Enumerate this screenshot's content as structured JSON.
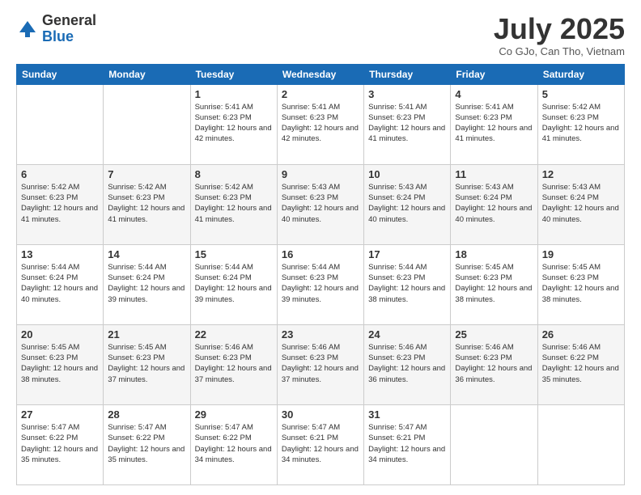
{
  "logo": {
    "general": "General",
    "blue": "Blue"
  },
  "header": {
    "month": "July 2025",
    "location": "Co GJo, Can Tho, Vietnam"
  },
  "days_of_week": [
    "Sunday",
    "Monday",
    "Tuesday",
    "Wednesday",
    "Thursday",
    "Friday",
    "Saturday"
  ],
  "weeks": [
    [
      {
        "day": "",
        "info": ""
      },
      {
        "day": "",
        "info": ""
      },
      {
        "day": "1",
        "info": "Sunrise: 5:41 AM\nSunset: 6:23 PM\nDaylight: 12 hours and 42 minutes."
      },
      {
        "day": "2",
        "info": "Sunrise: 5:41 AM\nSunset: 6:23 PM\nDaylight: 12 hours and 42 minutes."
      },
      {
        "day": "3",
        "info": "Sunrise: 5:41 AM\nSunset: 6:23 PM\nDaylight: 12 hours and 41 minutes."
      },
      {
        "day": "4",
        "info": "Sunrise: 5:41 AM\nSunset: 6:23 PM\nDaylight: 12 hours and 41 minutes."
      },
      {
        "day": "5",
        "info": "Sunrise: 5:42 AM\nSunset: 6:23 PM\nDaylight: 12 hours and 41 minutes."
      }
    ],
    [
      {
        "day": "6",
        "info": "Sunrise: 5:42 AM\nSunset: 6:23 PM\nDaylight: 12 hours and 41 minutes."
      },
      {
        "day": "7",
        "info": "Sunrise: 5:42 AM\nSunset: 6:23 PM\nDaylight: 12 hours and 41 minutes."
      },
      {
        "day": "8",
        "info": "Sunrise: 5:42 AM\nSunset: 6:23 PM\nDaylight: 12 hours and 41 minutes."
      },
      {
        "day": "9",
        "info": "Sunrise: 5:43 AM\nSunset: 6:23 PM\nDaylight: 12 hours and 40 minutes."
      },
      {
        "day": "10",
        "info": "Sunrise: 5:43 AM\nSunset: 6:24 PM\nDaylight: 12 hours and 40 minutes."
      },
      {
        "day": "11",
        "info": "Sunrise: 5:43 AM\nSunset: 6:24 PM\nDaylight: 12 hours and 40 minutes."
      },
      {
        "day": "12",
        "info": "Sunrise: 5:43 AM\nSunset: 6:24 PM\nDaylight: 12 hours and 40 minutes."
      }
    ],
    [
      {
        "day": "13",
        "info": "Sunrise: 5:44 AM\nSunset: 6:24 PM\nDaylight: 12 hours and 40 minutes."
      },
      {
        "day": "14",
        "info": "Sunrise: 5:44 AM\nSunset: 6:24 PM\nDaylight: 12 hours and 39 minutes."
      },
      {
        "day": "15",
        "info": "Sunrise: 5:44 AM\nSunset: 6:24 PM\nDaylight: 12 hours and 39 minutes."
      },
      {
        "day": "16",
        "info": "Sunrise: 5:44 AM\nSunset: 6:23 PM\nDaylight: 12 hours and 39 minutes."
      },
      {
        "day": "17",
        "info": "Sunrise: 5:44 AM\nSunset: 6:23 PM\nDaylight: 12 hours and 38 minutes."
      },
      {
        "day": "18",
        "info": "Sunrise: 5:45 AM\nSunset: 6:23 PM\nDaylight: 12 hours and 38 minutes."
      },
      {
        "day": "19",
        "info": "Sunrise: 5:45 AM\nSunset: 6:23 PM\nDaylight: 12 hours and 38 minutes."
      }
    ],
    [
      {
        "day": "20",
        "info": "Sunrise: 5:45 AM\nSunset: 6:23 PM\nDaylight: 12 hours and 38 minutes."
      },
      {
        "day": "21",
        "info": "Sunrise: 5:45 AM\nSunset: 6:23 PM\nDaylight: 12 hours and 37 minutes."
      },
      {
        "day": "22",
        "info": "Sunrise: 5:46 AM\nSunset: 6:23 PM\nDaylight: 12 hours and 37 minutes."
      },
      {
        "day": "23",
        "info": "Sunrise: 5:46 AM\nSunset: 6:23 PM\nDaylight: 12 hours and 37 minutes."
      },
      {
        "day": "24",
        "info": "Sunrise: 5:46 AM\nSunset: 6:23 PM\nDaylight: 12 hours and 36 minutes."
      },
      {
        "day": "25",
        "info": "Sunrise: 5:46 AM\nSunset: 6:23 PM\nDaylight: 12 hours and 36 minutes."
      },
      {
        "day": "26",
        "info": "Sunrise: 5:46 AM\nSunset: 6:22 PM\nDaylight: 12 hours and 35 minutes."
      }
    ],
    [
      {
        "day": "27",
        "info": "Sunrise: 5:47 AM\nSunset: 6:22 PM\nDaylight: 12 hours and 35 minutes."
      },
      {
        "day": "28",
        "info": "Sunrise: 5:47 AM\nSunset: 6:22 PM\nDaylight: 12 hours and 35 minutes."
      },
      {
        "day": "29",
        "info": "Sunrise: 5:47 AM\nSunset: 6:22 PM\nDaylight: 12 hours and 34 minutes."
      },
      {
        "day": "30",
        "info": "Sunrise: 5:47 AM\nSunset: 6:21 PM\nDaylight: 12 hours and 34 minutes."
      },
      {
        "day": "31",
        "info": "Sunrise: 5:47 AM\nSunset: 6:21 PM\nDaylight: 12 hours and 34 minutes."
      },
      {
        "day": "",
        "info": ""
      },
      {
        "day": "",
        "info": ""
      }
    ]
  ]
}
